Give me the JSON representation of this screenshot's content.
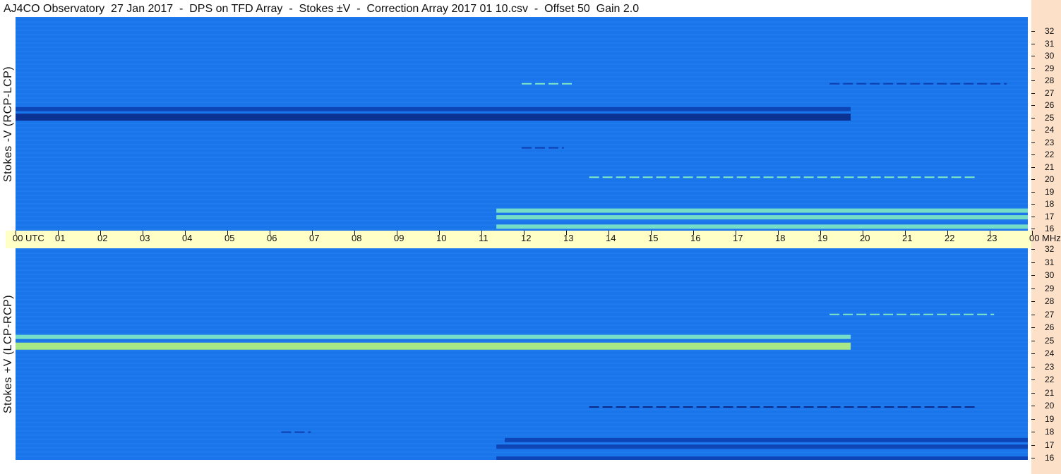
{
  "title": "AJ4CO Observatory  27 Jan 2017  -  DPS on TFD Array  -  Stokes ±V  -  Correction Array 2017 01 10.csv  -  Offset 50  Gain 2.0",
  "colors": {
    "background": "#1a74ea",
    "rail": "#fde0c8",
    "time_bar": "#ffffc6"
  },
  "chart_data": [
    {
      "type": "heatmap",
      "panel": "top",
      "ylabel": "Stokes -V  (RCP-LCP)",
      "x_unit": "UTC",
      "y_unit": "MHz",
      "x_ticks": [
        "00",
        "01",
        "02",
        "03",
        "04",
        "05",
        "06",
        "07",
        "08",
        "09",
        "10",
        "11",
        "12",
        "13",
        "14",
        "15",
        "16",
        "17",
        "18",
        "19",
        "20",
        "21",
        "22",
        "23",
        "00"
      ],
      "y_ticks": [
        32,
        31,
        30,
        29,
        28,
        27,
        26,
        25,
        24,
        23,
        22,
        21,
        20,
        19,
        18,
        17,
        16
      ],
      "xlim": [
        0,
        24
      ],
      "ylim": [
        16,
        32
      ],
      "features": [
        {
          "kind": "dark-band",
          "freq_mhz": 24.5,
          "start_utc": 0.0,
          "end_utc": 19.8,
          "level": "deep-negative"
        },
        {
          "kind": "dark-band",
          "freq_mhz": 25.1,
          "start_utc": 0.0,
          "end_utc": 19.8,
          "level": "negative"
        },
        {
          "kind": "bright-band",
          "freq_mhz": 17.5,
          "start_utc": 11.4,
          "end_utc": 24.0,
          "level": "positive"
        },
        {
          "kind": "bright-band",
          "freq_mhz": 17.0,
          "start_utc": 11.4,
          "end_utc": 24.0,
          "level": "positive"
        },
        {
          "kind": "bright-band",
          "freq_mhz": 16.3,
          "start_utc": 11.4,
          "end_utc": 24.0,
          "level": "positive"
        },
        {
          "kind": "dashed-line",
          "freq_mhz": 20.0,
          "start_utc": 13.6,
          "end_utc": 22.8,
          "level": "positive"
        },
        {
          "kind": "dashed-line",
          "freq_mhz": 22.2,
          "start_utc": 12.0,
          "end_utc": 13.0,
          "level": "negative"
        },
        {
          "kind": "dashed-line",
          "freq_mhz": 27.0,
          "start_utc": 19.3,
          "end_utc": 23.5,
          "level": "negative"
        },
        {
          "kind": "dashed-line",
          "freq_mhz": 27.0,
          "start_utc": 12.0,
          "end_utc": 13.2,
          "level": "positive"
        }
      ]
    },
    {
      "type": "heatmap",
      "panel": "bottom",
      "ylabel": "Stokes +V  (LCP-RCP)",
      "x_unit": "UTC",
      "y_unit": "MHz",
      "x_ticks": [
        "00",
        "01",
        "02",
        "03",
        "04",
        "05",
        "06",
        "07",
        "08",
        "09",
        "10",
        "11",
        "12",
        "13",
        "14",
        "15",
        "16",
        "17",
        "18",
        "19",
        "20",
        "21",
        "22",
        "23",
        "00"
      ],
      "y_ticks": [
        32,
        31,
        30,
        29,
        28,
        27,
        26,
        25,
        24,
        23,
        22,
        21,
        20,
        19,
        18,
        17,
        16
      ],
      "xlim": [
        0,
        24
      ],
      "ylim": [
        16,
        32
      ],
      "features": [
        {
          "kind": "bright-band",
          "freq_mhz": 24.6,
          "start_utc": 0.0,
          "end_utc": 19.8,
          "level": "strong-positive"
        },
        {
          "kind": "bright-band",
          "freq_mhz": 25.3,
          "start_utc": 0.0,
          "end_utc": 19.8,
          "level": "positive"
        },
        {
          "kind": "dark-band",
          "freq_mhz": 17.5,
          "start_utc": 11.6,
          "end_utc": 24.0,
          "level": "negative"
        },
        {
          "kind": "dark-band",
          "freq_mhz": 17.0,
          "start_utc": 11.4,
          "end_utc": 24.0,
          "level": "negative"
        },
        {
          "kind": "dark-band",
          "freq_mhz": 16.1,
          "start_utc": 11.4,
          "end_utc": 24.0,
          "level": "negative"
        },
        {
          "kind": "dashed-line",
          "freq_mhz": 20.0,
          "start_utc": 13.6,
          "end_utc": 22.8,
          "level": "deep-negative"
        },
        {
          "kind": "dashed-line",
          "freq_mhz": 27.0,
          "start_utc": 19.3,
          "end_utc": 23.2,
          "level": "positive"
        },
        {
          "kind": "dashed-line",
          "freq_mhz": 18.1,
          "start_utc": 6.3,
          "end_utc": 7.0,
          "level": "negative"
        }
      ]
    }
  ],
  "time_axis": {
    "utc_label": "UTC",
    "mhz_label": "MHz"
  }
}
